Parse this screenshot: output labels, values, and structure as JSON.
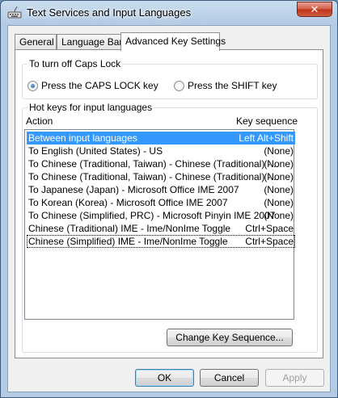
{
  "window": {
    "title": "Text Services and Input Languages",
    "close_label": "✕"
  },
  "tabs": [
    {
      "label": "General"
    },
    {
      "label": "Language Bar"
    },
    {
      "label": "Advanced Key Settings"
    }
  ],
  "caps_lock": {
    "group_label": "To turn off Caps Lock",
    "option_caps": "Press the CAPS LOCK key",
    "option_shift": "Press the SHIFT key"
  },
  "hotkeys": {
    "group_label": "Hot keys for input languages",
    "col_action": "Action",
    "col_sequence": "Key sequence",
    "rows": [
      {
        "action": "Between input languages",
        "sequence": "Left Alt+Shift"
      },
      {
        "action": "To English (United States) - US",
        "sequence": "(None)"
      },
      {
        "action": "To Chinese (Traditional, Taiwan) - Chinese (Traditional) -...",
        "sequence": "(None)"
      },
      {
        "action": "To Chinese (Traditional, Taiwan) - Chinese (Traditional) -...",
        "sequence": "(None)"
      },
      {
        "action": "To Japanese (Japan) - Microsoft Office IME 2007",
        "sequence": "(None)"
      },
      {
        "action": "To Korean (Korea) - Microsoft Office IME 2007",
        "sequence": "(None)"
      },
      {
        "action": "To Chinese (Simplified, PRC) - Microsoft Pinyin IME 2007",
        "sequence": "(None)"
      },
      {
        "action": "Chinese (Traditional) IME - Ime/NonIme Toggle",
        "sequence": "Ctrl+Space"
      },
      {
        "action": "Chinese (Simplified) IME - Ime/NonIme Toggle",
        "sequence": "Ctrl+Space"
      }
    ],
    "change_button": "Change Key Sequence..."
  },
  "footer": {
    "ok": "OK",
    "cancel": "Cancel",
    "apply": "Apply"
  }
}
